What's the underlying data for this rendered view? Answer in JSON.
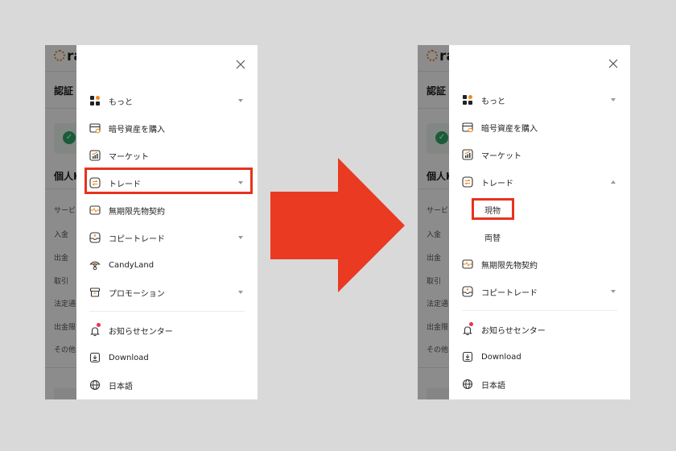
{
  "colors": {
    "highlight": "#e8321e",
    "arrow": "#ea3a22",
    "accent_orange": "#f08a1c",
    "notification_dot": "#f03050",
    "success_green": "#2fa86a"
  },
  "background_page": {
    "logo_text": "ra",
    "section_title": "認証",
    "subsection_title": "個人K",
    "items": [
      "サービ",
      "入金",
      "出金",
      "取引",
      "法定通",
      "出金限",
      "その他"
    ]
  },
  "left_panel": {
    "close_icon": "close-icon",
    "menu": [
      {
        "label": "もっと",
        "icon": "grid-icon",
        "expandable": true
      },
      {
        "label": "暗号資産を購入",
        "icon": "card-icon",
        "expandable": false
      },
      {
        "label": "マーケット",
        "icon": "chart-icon",
        "expandable": false
      },
      {
        "label": "トレード",
        "icon": "swap-icon",
        "expandable": true,
        "highlighted": true
      },
      {
        "label": "無期限先物契約",
        "icon": "pulse-icon",
        "expandable": false
      },
      {
        "label": "コピートレード",
        "icon": "inbox-icon",
        "expandable": true
      },
      {
        "label": "CandyLand",
        "icon": "candy-icon",
        "expandable": false
      },
      {
        "label": "プロモーション",
        "icon": "gift-icon",
        "expandable": true
      }
    ],
    "footer_menu": [
      {
        "label": "お知らせセンター",
        "icon": "bell-icon",
        "has_notification": true
      },
      {
        "label": "Download",
        "icon": "download-icon"
      },
      {
        "label": "日本語",
        "icon": "globe-icon"
      }
    ]
  },
  "right_panel": {
    "menu": [
      {
        "label": "もっと",
        "icon": "grid-icon",
        "expandable": true
      },
      {
        "label": "暗号資産を購入",
        "icon": "card-icon"
      },
      {
        "label": "マーケット",
        "icon": "chart-icon"
      },
      {
        "label": "トレード",
        "icon": "swap-icon",
        "expandable": true,
        "expanded": true,
        "submenu": [
          {
            "label": "現物",
            "highlighted": true
          },
          {
            "label": "両替"
          }
        ]
      },
      {
        "label": "無期限先物契約",
        "icon": "pulse-icon"
      },
      {
        "label": "コピートレード",
        "icon": "inbox-icon",
        "expandable": true
      }
    ],
    "footer_menu": [
      {
        "label": "お知らせセンター",
        "icon": "bell-icon",
        "has_notification": true
      },
      {
        "label": "Download",
        "icon": "download-icon"
      },
      {
        "label": "日本語",
        "icon": "globe-icon"
      }
    ]
  },
  "annotation": {
    "arrow": "right-arrow"
  }
}
